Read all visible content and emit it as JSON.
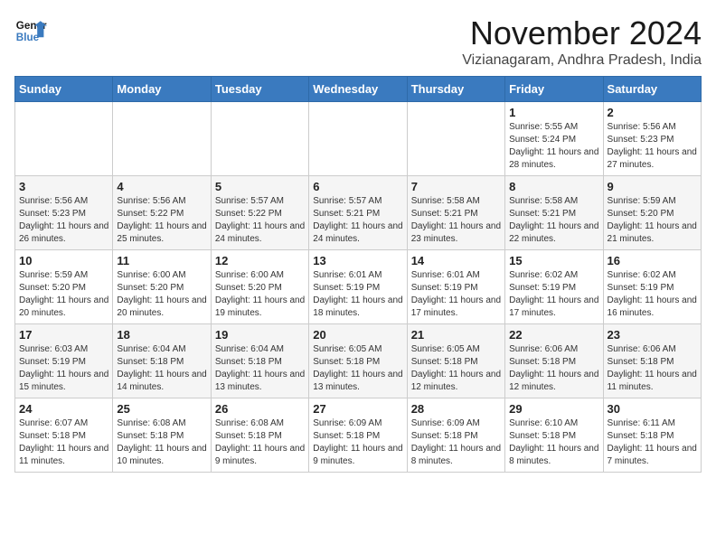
{
  "header": {
    "logo_line1": "General",
    "logo_line2": "Blue",
    "month": "November 2024",
    "location": "Vizianagaram, Andhra Pradesh, India"
  },
  "weekdays": [
    "Sunday",
    "Monday",
    "Tuesday",
    "Wednesday",
    "Thursday",
    "Friday",
    "Saturday"
  ],
  "weeks": [
    [
      {
        "day": "",
        "info": ""
      },
      {
        "day": "",
        "info": ""
      },
      {
        "day": "",
        "info": ""
      },
      {
        "day": "",
        "info": ""
      },
      {
        "day": "",
        "info": ""
      },
      {
        "day": "1",
        "info": "Sunrise: 5:55 AM\nSunset: 5:24 PM\nDaylight: 11 hours and 28 minutes."
      },
      {
        "day": "2",
        "info": "Sunrise: 5:56 AM\nSunset: 5:23 PM\nDaylight: 11 hours and 27 minutes."
      }
    ],
    [
      {
        "day": "3",
        "info": "Sunrise: 5:56 AM\nSunset: 5:23 PM\nDaylight: 11 hours and 26 minutes."
      },
      {
        "day": "4",
        "info": "Sunrise: 5:56 AM\nSunset: 5:22 PM\nDaylight: 11 hours and 25 minutes."
      },
      {
        "day": "5",
        "info": "Sunrise: 5:57 AM\nSunset: 5:22 PM\nDaylight: 11 hours and 24 minutes."
      },
      {
        "day": "6",
        "info": "Sunrise: 5:57 AM\nSunset: 5:21 PM\nDaylight: 11 hours and 24 minutes."
      },
      {
        "day": "7",
        "info": "Sunrise: 5:58 AM\nSunset: 5:21 PM\nDaylight: 11 hours and 23 minutes."
      },
      {
        "day": "8",
        "info": "Sunrise: 5:58 AM\nSunset: 5:21 PM\nDaylight: 11 hours and 22 minutes."
      },
      {
        "day": "9",
        "info": "Sunrise: 5:59 AM\nSunset: 5:20 PM\nDaylight: 11 hours and 21 minutes."
      }
    ],
    [
      {
        "day": "10",
        "info": "Sunrise: 5:59 AM\nSunset: 5:20 PM\nDaylight: 11 hours and 20 minutes."
      },
      {
        "day": "11",
        "info": "Sunrise: 6:00 AM\nSunset: 5:20 PM\nDaylight: 11 hours and 20 minutes."
      },
      {
        "day": "12",
        "info": "Sunrise: 6:00 AM\nSunset: 5:20 PM\nDaylight: 11 hours and 19 minutes."
      },
      {
        "day": "13",
        "info": "Sunrise: 6:01 AM\nSunset: 5:19 PM\nDaylight: 11 hours and 18 minutes."
      },
      {
        "day": "14",
        "info": "Sunrise: 6:01 AM\nSunset: 5:19 PM\nDaylight: 11 hours and 17 minutes."
      },
      {
        "day": "15",
        "info": "Sunrise: 6:02 AM\nSunset: 5:19 PM\nDaylight: 11 hours and 17 minutes."
      },
      {
        "day": "16",
        "info": "Sunrise: 6:02 AM\nSunset: 5:19 PM\nDaylight: 11 hours and 16 minutes."
      }
    ],
    [
      {
        "day": "17",
        "info": "Sunrise: 6:03 AM\nSunset: 5:19 PM\nDaylight: 11 hours and 15 minutes."
      },
      {
        "day": "18",
        "info": "Sunrise: 6:04 AM\nSunset: 5:18 PM\nDaylight: 11 hours and 14 minutes."
      },
      {
        "day": "19",
        "info": "Sunrise: 6:04 AM\nSunset: 5:18 PM\nDaylight: 11 hours and 13 minutes."
      },
      {
        "day": "20",
        "info": "Sunrise: 6:05 AM\nSunset: 5:18 PM\nDaylight: 11 hours and 13 minutes."
      },
      {
        "day": "21",
        "info": "Sunrise: 6:05 AM\nSunset: 5:18 PM\nDaylight: 11 hours and 12 minutes."
      },
      {
        "day": "22",
        "info": "Sunrise: 6:06 AM\nSunset: 5:18 PM\nDaylight: 11 hours and 12 minutes."
      },
      {
        "day": "23",
        "info": "Sunrise: 6:06 AM\nSunset: 5:18 PM\nDaylight: 11 hours and 11 minutes."
      }
    ],
    [
      {
        "day": "24",
        "info": "Sunrise: 6:07 AM\nSunset: 5:18 PM\nDaylight: 11 hours and 11 minutes."
      },
      {
        "day": "25",
        "info": "Sunrise: 6:08 AM\nSunset: 5:18 PM\nDaylight: 11 hours and 10 minutes."
      },
      {
        "day": "26",
        "info": "Sunrise: 6:08 AM\nSunset: 5:18 PM\nDaylight: 11 hours and 9 minutes."
      },
      {
        "day": "27",
        "info": "Sunrise: 6:09 AM\nSunset: 5:18 PM\nDaylight: 11 hours and 9 minutes."
      },
      {
        "day": "28",
        "info": "Sunrise: 6:09 AM\nSunset: 5:18 PM\nDaylight: 11 hours and 8 minutes."
      },
      {
        "day": "29",
        "info": "Sunrise: 6:10 AM\nSunset: 5:18 PM\nDaylight: 11 hours and 8 minutes."
      },
      {
        "day": "30",
        "info": "Sunrise: 6:11 AM\nSunset: 5:18 PM\nDaylight: 11 hours and 7 minutes."
      }
    ]
  ]
}
